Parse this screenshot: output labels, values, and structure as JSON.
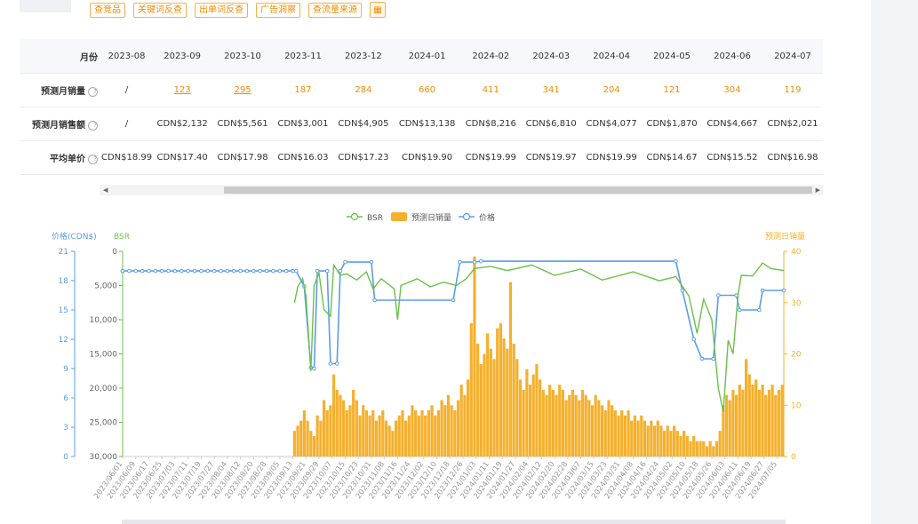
{
  "toolbar": {
    "buttons": [
      "查竞品",
      "关键词反查",
      "出单词反查",
      "广告洞察",
      "查流量来源"
    ]
  },
  "table": {
    "header_label": "月份",
    "months": [
      "2023-08",
      "2023-09",
      "2023-10",
      "2023-11",
      "2023-12",
      "2024-01",
      "2024-02",
      "2024-03",
      "2024-04",
      "2024-05",
      "2024-06",
      "2024-07"
    ],
    "rows": [
      {
        "label": "预测月销量",
        "values": [
          "/",
          "123",
          "295",
          "187",
          "284",
          "660",
          "411",
          "341",
          "204",
          "121",
          "304",
          "119"
        ]
      },
      {
        "label": "预测月销售额",
        "values": [
          "/",
          "CDN$2,132",
          "CDN$5,561",
          "CDN$3,001",
          "CDN$4,905",
          "CDN$13,138",
          "CDN$8,216",
          "CDN$6,810",
          "CDN$4,077",
          "CDN$1,870",
          "CDN$4,667",
          "CDN$2,021"
        ]
      },
      {
        "label": "平均单价",
        "values": [
          "CDN$18.99",
          "CDN$17.40",
          "CDN$17.98",
          "CDN$16.03",
          "CDN$17.23",
          "CDN$19.90",
          "CDN$19.99",
          "CDN$19.97",
          "CDN$19.99",
          "CDN$14.67",
          "CDN$15.52",
          "CDN$16.98"
        ]
      }
    ]
  },
  "chart_data": {
    "type": "line",
    "colors": {
      "bsr": "#6cc04a",
      "sales": "#f5b02e",
      "price": "#5b9ee6"
    },
    "legend": [
      "BSR",
      "预测日销量",
      "价格"
    ],
    "legend_position": "top-center",
    "axes": {
      "price": {
        "label": "价格(CDN$)",
        "ticks": [
          "21",
          "18",
          "15",
          "12",
          "9",
          "6",
          "3",
          "0"
        ],
        "range": [
          0,
          21
        ]
      },
      "bsr": {
        "label": "BSR",
        "ticks": [
          "0",
          "5,000",
          "10,000",
          "15,000",
          "20,000",
          "25,000",
          "30,000"
        ],
        "range": [
          0,
          30000
        ],
        "inverted": true
      },
      "sales": {
        "label": "预测日销量",
        "ticks": [
          "40",
          "30",
          "20",
          "10",
          "0"
        ],
        "range": [
          0,
          40
        ]
      }
    },
    "x_labels": [
      "2023/06/01",
      "2023/06/09",
      "2023/06/17",
      "2023/06/25",
      "2023/07/03",
      "2023/07/11",
      "2023/07/19",
      "2023/07/27",
      "2023/08/04",
      "2023/08/12",
      "2023/08/20",
      "2023/08/28",
      "2023/09/05",
      "2023/09/13",
      "2023/09/21",
      "2023/09/29",
      "2023/10/07",
      "2023/10/15",
      "2023/10/23",
      "2023/10/31",
      "2023/11/08",
      "2023/11/16",
      "2023/11/24",
      "2023/12/02",
      "2023/12/10",
      "2023/12/18",
      "2023/12/26",
      "2024/01/03",
      "2024/01/11",
      "2024/01/19",
      "2024/01/27",
      "2024/02/04",
      "2024/02/12",
      "2024/02/20",
      "2024/02/28",
      "2024/03/07",
      "2024/03/15",
      "2024/03/23",
      "2024/03/31",
      "2024/04/08",
      "2024/04/16",
      "2024/04/24",
      "2024/05/02",
      "2024/05/10",
      "2024/05/18",
      "2024/05/26",
      "2024/06/03",
      "2024/06/11",
      "2024/06/19",
      "2024/06/27",
      "2024/07/05"
    ],
    "price_series": [
      [
        "2023-06-01",
        18.99
      ],
      [
        "2023-09-15",
        18.99
      ],
      [
        "2023-09-20",
        17.4
      ],
      [
        "2023-09-24",
        9.1
      ],
      [
        "2023-09-26",
        9.0
      ],
      [
        "2023-09-28",
        18.99
      ],
      [
        "2023-10-04",
        18.99
      ],
      [
        "2023-10-06",
        9.5
      ],
      [
        "2023-10-10",
        9.5
      ],
      [
        "2023-10-12",
        18.99
      ],
      [
        "2023-10-15",
        19.9
      ],
      [
        "2023-10-31",
        19.9
      ],
      [
        "2023-11-02",
        16.0
      ],
      [
        "2023-12-20",
        16.0
      ],
      [
        "2023-12-24",
        19.9
      ],
      [
        "2024-01-02",
        19.9
      ],
      [
        "2024-01-06",
        19.99
      ],
      [
        "2024-05-04",
        19.99
      ],
      [
        "2024-05-08",
        17.0
      ],
      [
        "2024-05-15",
        12.0
      ],
      [
        "2024-05-20",
        10.0
      ],
      [
        "2024-05-27",
        10.0
      ],
      [
        "2024-05-30",
        16.5
      ],
      [
        "2024-06-10",
        16.5
      ],
      [
        "2024-06-12",
        15.0
      ],
      [
        "2024-06-24",
        15.0
      ],
      [
        "2024-06-26",
        17.0
      ],
      [
        "2024-07-09",
        17.0
      ]
    ],
    "bsr_series": [
      [
        "2023-09-14",
        7500
      ],
      [
        "2023-09-16",
        5200
      ],
      [
        "2023-09-19",
        4000
      ],
      [
        "2023-09-21",
        6500
      ],
      [
        "2023-09-24",
        17500
      ],
      [
        "2023-09-26",
        5000
      ],
      [
        "2023-09-29",
        3200
      ],
      [
        "2023-10-02",
        8500
      ],
      [
        "2023-10-06",
        9500
      ],
      [
        "2023-10-08",
        2000
      ],
      [
        "2023-10-12",
        3500
      ],
      [
        "2023-10-16",
        3300
      ],
      [
        "2023-10-22",
        4200
      ],
      [
        "2023-10-28",
        3000
      ],
      [
        "2023-11-01",
        5500
      ],
      [
        "2023-11-06",
        4000
      ],
      [
        "2023-11-14",
        5500
      ],
      [
        "2023-11-16",
        10000
      ],
      [
        "2023-11-18",
        5000
      ],
      [
        "2023-11-28",
        4000
      ],
      [
        "2023-12-06",
        5200
      ],
      [
        "2023-12-14",
        4500
      ],
      [
        "2023-12-22",
        5000
      ],
      [
        "2023-12-28",
        4000
      ],
      [
        "2024-01-02",
        2500
      ],
      [
        "2024-01-12",
        2200
      ],
      [
        "2024-01-22",
        2800
      ],
      [
        "2024-02-06",
        2000
      ],
      [
        "2024-02-20",
        3500
      ],
      [
        "2024-03-07",
        2600
      ],
      [
        "2024-03-20",
        4200
      ],
      [
        "2024-04-08",
        3000
      ],
      [
        "2024-04-24",
        4300
      ],
      [
        "2024-05-04",
        3700
      ],
      [
        "2024-05-12",
        6500
      ],
      [
        "2024-05-17",
        12000
      ],
      [
        "2024-05-21",
        7000
      ],
      [
        "2024-05-26",
        10000
      ],
      [
        "2024-05-30",
        20000
      ],
      [
        "2024-06-02",
        23500
      ],
      [
        "2024-06-05",
        13000
      ],
      [
        "2024-06-08",
        15000
      ],
      [
        "2024-06-11",
        6500
      ],
      [
        "2024-06-13",
        3500
      ],
      [
        "2024-06-20",
        3600
      ],
      [
        "2024-06-26",
        1700
      ],
      [
        "2024-07-01",
        2500
      ],
      [
        "2024-07-09",
        2800
      ]
    ],
    "sales_series": [
      [
        "2023-09-14",
        5
      ],
      [
        "2023-09-16",
        6
      ],
      [
        "2023-09-18",
        7
      ],
      [
        "2023-09-20",
        9
      ],
      [
        "2023-09-22",
        7
      ],
      [
        "2023-09-24",
        5
      ],
      [
        "2023-09-26",
        4
      ],
      [
        "2023-09-28",
        8
      ],
      [
        "2023-09-30",
        7
      ],
      [
        "2023-10-02",
        11
      ],
      [
        "2023-10-04",
        9
      ],
      [
        "2023-10-06",
        10
      ],
      [
        "2023-10-08",
        16
      ],
      [
        "2023-10-10",
        13
      ],
      [
        "2023-10-12",
        12
      ],
      [
        "2023-10-14",
        11
      ],
      [
        "2023-10-16",
        9
      ],
      [
        "2023-10-18",
        10
      ],
      [
        "2023-10-20",
        13
      ],
      [
        "2023-10-22",
        11
      ],
      [
        "2023-10-24",
        8
      ],
      [
        "2023-10-26",
        10
      ],
      [
        "2023-10-28",
        9
      ],
      [
        "2023-10-30",
        8
      ],
      [
        "2023-11-01",
        9
      ],
      [
        "2023-11-03",
        7
      ],
      [
        "2023-11-05",
        8
      ],
      [
        "2023-11-07",
        9
      ],
      [
        "2023-11-09",
        7
      ],
      [
        "2023-11-11",
        6
      ],
      [
        "2023-11-13",
        5
      ],
      [
        "2023-11-15",
        7
      ],
      [
        "2023-11-17",
        8
      ],
      [
        "2023-11-19",
        9
      ],
      [
        "2023-11-21",
        7
      ],
      [
        "2023-11-23",
        8
      ],
      [
        "2023-11-25",
        10
      ],
      [
        "2023-11-27",
        9
      ],
      [
        "2023-11-29",
        8
      ],
      [
        "2023-12-01",
        9
      ],
      [
        "2023-12-03",
        8
      ],
      [
        "2023-12-05",
        9
      ],
      [
        "2023-12-07",
        10
      ],
      [
        "2023-12-09",
        8
      ],
      [
        "2023-12-11",
        9
      ],
      [
        "2023-12-13",
        11
      ],
      [
        "2023-12-15",
        10
      ],
      [
        "2023-12-17",
        12
      ],
      [
        "2023-12-19",
        10
      ],
      [
        "2023-12-21",
        9
      ],
      [
        "2023-12-23",
        11
      ],
      [
        "2023-12-25",
        14
      ],
      [
        "2023-12-27",
        12
      ],
      [
        "2023-12-29",
        15
      ],
      [
        "2023-12-31",
        26
      ],
      [
        "2024-01-02",
        39
      ],
      [
        "2024-01-04",
        22
      ],
      [
        "2024-01-06",
        18
      ],
      [
        "2024-01-08",
        20
      ],
      [
        "2024-01-10",
        24
      ],
      [
        "2024-01-12",
        21
      ],
      [
        "2024-01-14",
        19
      ],
      [
        "2024-01-16",
        25
      ],
      [
        "2024-01-18",
        26
      ],
      [
        "2024-01-20",
        23
      ],
      [
        "2024-01-22",
        21
      ],
      [
        "2024-01-24",
        34
      ],
      [
        "2024-01-26",
        22
      ],
      [
        "2024-01-28",
        19
      ],
      [
        "2024-01-30",
        15
      ],
      [
        "2024-02-01",
        13
      ],
      [
        "2024-02-03",
        17
      ],
      [
        "2024-02-05",
        14
      ],
      [
        "2024-02-07",
        16
      ],
      [
        "2024-02-09",
        18
      ],
      [
        "2024-02-11",
        15
      ],
      [
        "2024-02-13",
        13
      ],
      [
        "2024-02-15",
        12
      ],
      [
        "2024-02-17",
        14
      ],
      [
        "2024-02-19",
        13
      ],
      [
        "2024-02-21",
        12
      ],
      [
        "2024-02-23",
        14
      ],
      [
        "2024-02-25",
        13
      ],
      [
        "2024-02-27",
        11
      ],
      [
        "2024-02-29",
        12
      ],
      [
        "2024-03-02",
        13
      ],
      [
        "2024-03-04",
        12
      ],
      [
        "2024-03-06",
        11
      ],
      [
        "2024-03-08",
        13
      ],
      [
        "2024-03-10",
        12
      ],
      [
        "2024-03-12",
        11
      ],
      [
        "2024-03-14",
        10
      ],
      [
        "2024-03-16",
        12
      ],
      [
        "2024-03-18",
        11
      ],
      [
        "2024-03-20",
        10
      ],
      [
        "2024-03-22",
        9
      ],
      [
        "2024-03-24",
        11
      ],
      [
        "2024-03-26",
        10
      ],
      [
        "2024-03-28",
        9
      ],
      [
        "2024-03-30",
        8
      ],
      [
        "2024-04-01",
        9
      ],
      [
        "2024-04-03",
        8
      ],
      [
        "2024-04-05",
        9
      ],
      [
        "2024-04-07",
        7
      ],
      [
        "2024-04-09",
        8
      ],
      [
        "2024-04-11",
        7
      ],
      [
        "2024-04-13",
        8
      ],
      [
        "2024-04-15",
        7
      ],
      [
        "2024-04-17",
        6
      ],
      [
        "2024-04-19",
        7
      ],
      [
        "2024-04-21",
        6
      ],
      [
        "2024-04-23",
        7
      ],
      [
        "2024-04-25",
        6
      ],
      [
        "2024-04-27",
        5
      ],
      [
        "2024-04-29",
        6
      ],
      [
        "2024-05-01",
        5
      ],
      [
        "2024-05-03",
        6
      ],
      [
        "2024-05-05",
        5
      ],
      [
        "2024-05-07",
        4
      ],
      [
        "2024-05-09",
        5
      ],
      [
        "2024-05-11",
        4
      ],
      [
        "2024-05-13",
        3
      ],
      [
        "2024-05-15",
        4
      ],
      [
        "2024-05-17",
        3
      ],
      [
        "2024-05-19",
        3
      ],
      [
        "2024-05-21",
        3
      ],
      [
        "2024-05-23",
        2
      ],
      [
        "2024-05-25",
        3
      ],
      [
        "2024-05-27",
        2
      ],
      [
        "2024-05-29",
        3
      ],
      [
        "2024-05-31",
        5
      ],
      [
        "2024-06-02",
        10
      ],
      [
        "2024-06-04",
        12
      ],
      [
        "2024-06-06",
        11
      ],
      [
        "2024-06-08",
        13
      ],
      [
        "2024-06-10",
        12
      ],
      [
        "2024-06-12",
        14
      ],
      [
        "2024-06-14",
        13
      ],
      [
        "2024-06-16",
        19
      ],
      [
        "2024-06-18",
        16
      ],
      [
        "2024-06-20",
        14
      ],
      [
        "2024-06-22",
        15
      ],
      [
        "2024-06-24",
        13
      ],
      [
        "2024-06-26",
        14
      ],
      [
        "2024-06-28",
        12
      ],
      [
        "2024-06-30",
        13
      ],
      [
        "2024-07-02",
        14
      ],
      [
        "2024-07-04",
        12
      ],
      [
        "2024-07-06",
        13
      ],
      [
        "2024-07-08",
        14
      ]
    ]
  }
}
